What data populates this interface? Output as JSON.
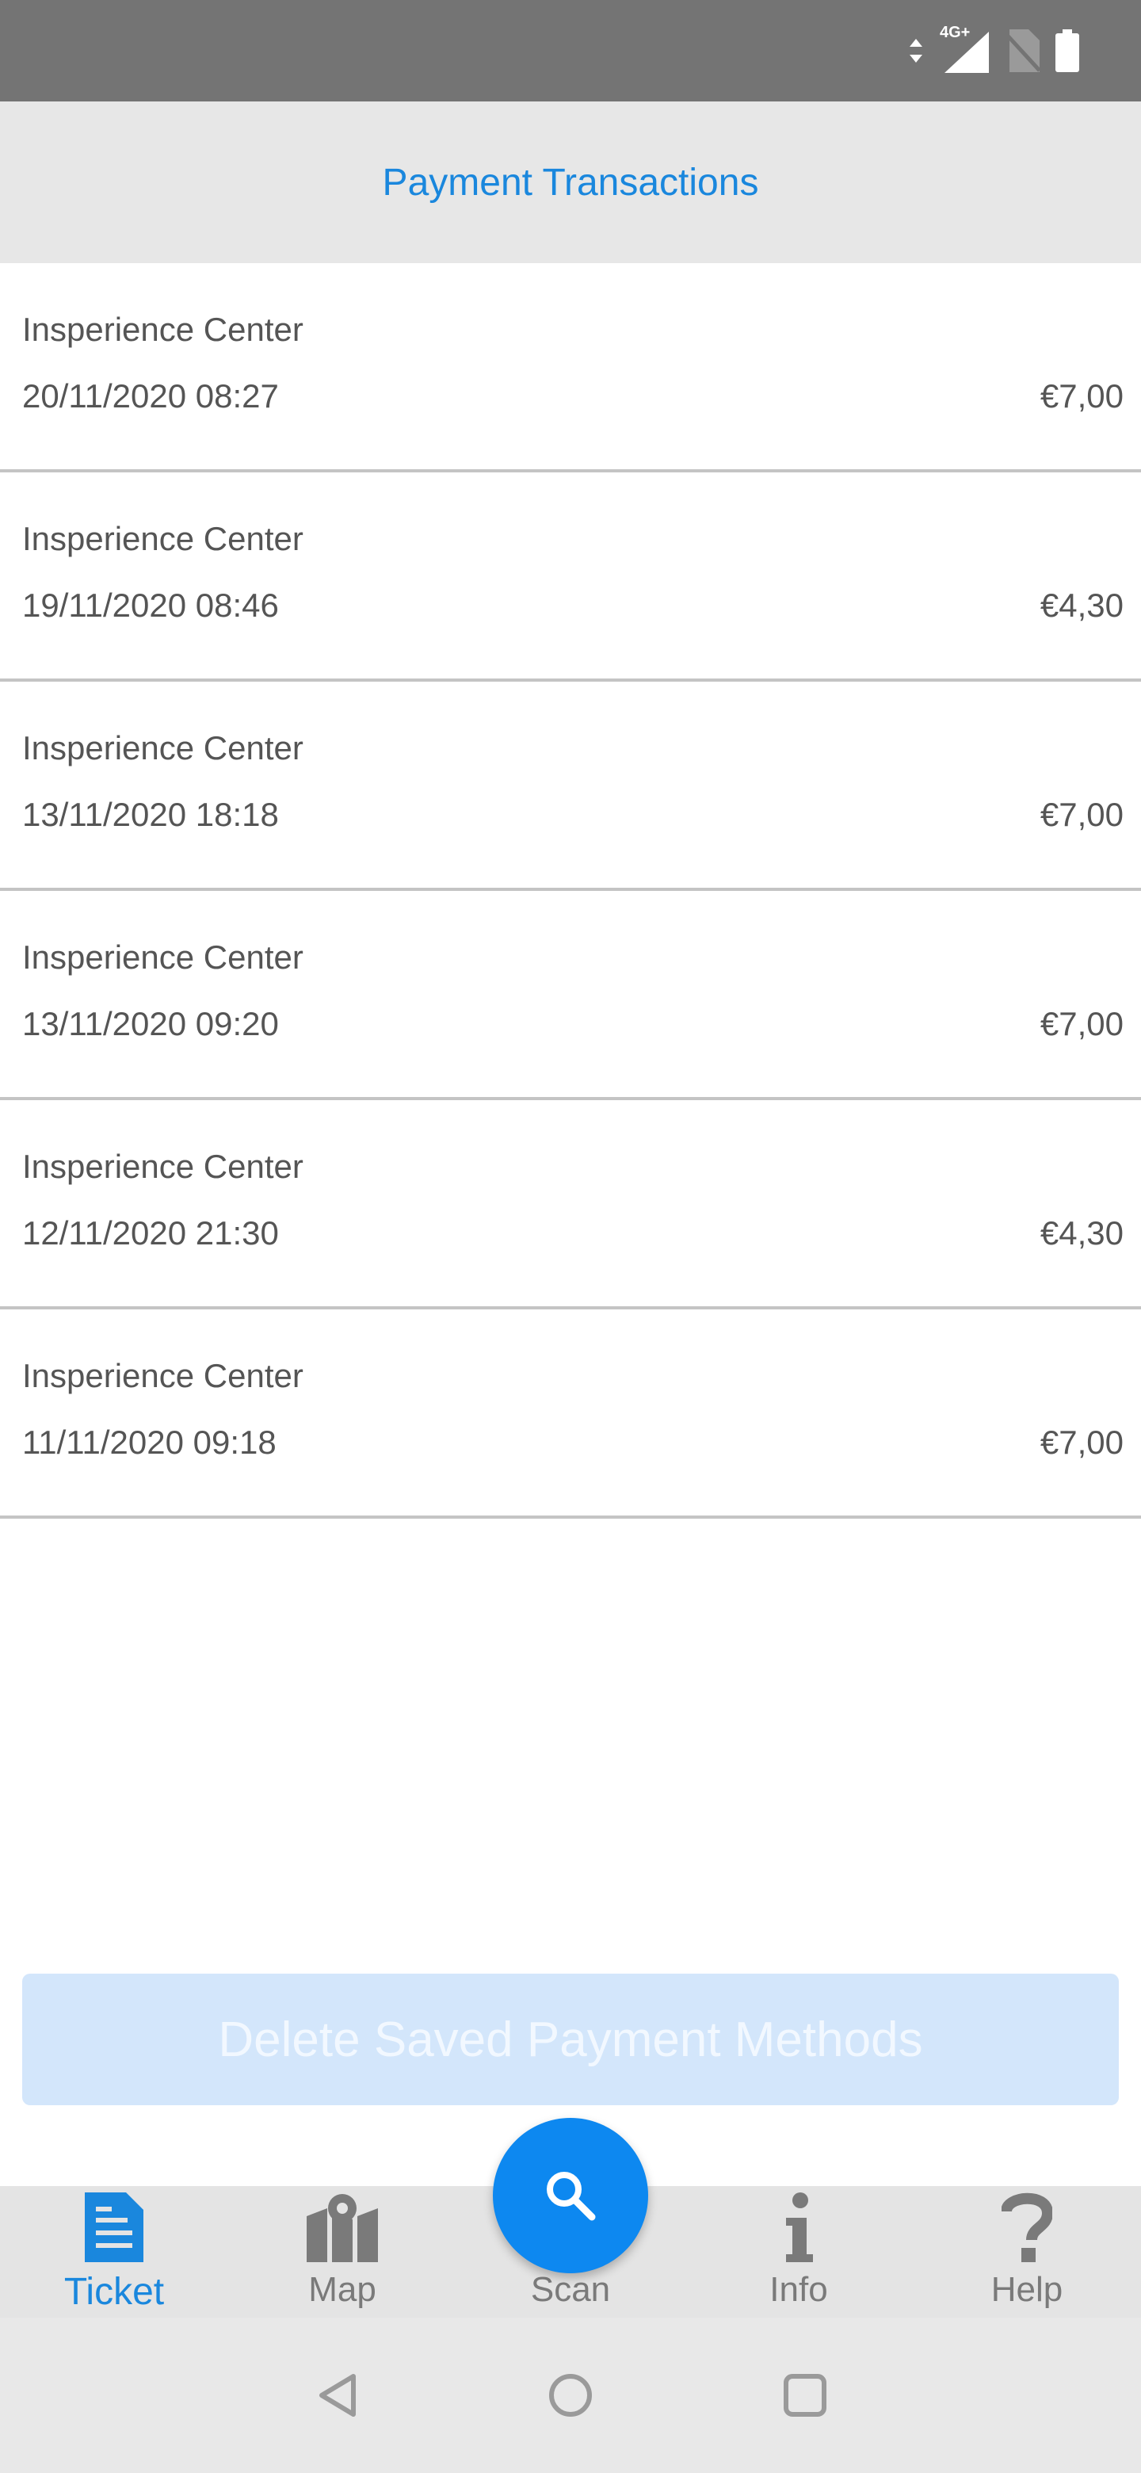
{
  "header": {
    "title": "Payment Transactions"
  },
  "transactions": [
    {
      "merchant": "Insperience Center",
      "datetime": "20/11/2020 08:27",
      "amount": "€7,00"
    },
    {
      "merchant": "Insperience Center",
      "datetime": "19/11/2020 08:46",
      "amount": "€4,30"
    },
    {
      "merchant": "Insperience Center",
      "datetime": "13/11/2020 18:18",
      "amount": "€7,00"
    },
    {
      "merchant": "Insperience Center",
      "datetime": "13/11/2020 09:20",
      "amount": "€7,00"
    },
    {
      "merchant": "Insperience Center",
      "datetime": "12/11/2020 21:30",
      "amount": "€4,30"
    },
    {
      "merchant": "Insperience Center",
      "datetime": "11/11/2020 09:18",
      "amount": "€7,00"
    }
  ],
  "actions": {
    "delete_label": "Delete Saved Payment Methods"
  },
  "nav": {
    "ticket": "Ticket",
    "map": "Map",
    "scan": "Scan",
    "info": "Info",
    "help": "Help",
    "active": "ticket"
  },
  "status_bar": {
    "network": "4G+"
  },
  "colors": {
    "accent": "#1a87dd",
    "fab": "#0d88f0",
    "disabled_button": "#d3e6fb"
  }
}
